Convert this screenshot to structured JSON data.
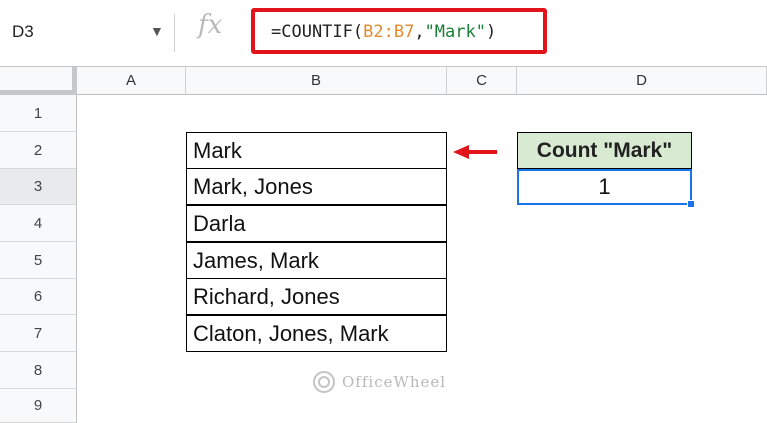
{
  "formula_bar": {
    "cell_ref": "D3",
    "fx_label": "fx",
    "formula": {
      "prefix": "=COUNTIF(",
      "range": "B2:B7",
      "comma": ",",
      "criteria": "\"Mark\"",
      "suffix": ")"
    }
  },
  "columns": [
    "A",
    "B",
    "C",
    "D"
  ],
  "rows": [
    "1",
    "2",
    "3",
    "4",
    "5",
    "6",
    "7",
    "8",
    "9"
  ],
  "selected_row": "3",
  "names": [
    "Mark",
    "Mark, Jones",
    "Darla",
    "James, Mark",
    "Richard, Jones",
    "Claton, Jones, Mark"
  ],
  "result": {
    "header": "Count \"Mark\"",
    "value": "1"
  },
  "colors": {
    "highlight_red": "#e0141a",
    "selection_blue": "#1a73e8",
    "header_green": "#d9ead3"
  },
  "watermark": {
    "text": "OfficeWheel"
  }
}
